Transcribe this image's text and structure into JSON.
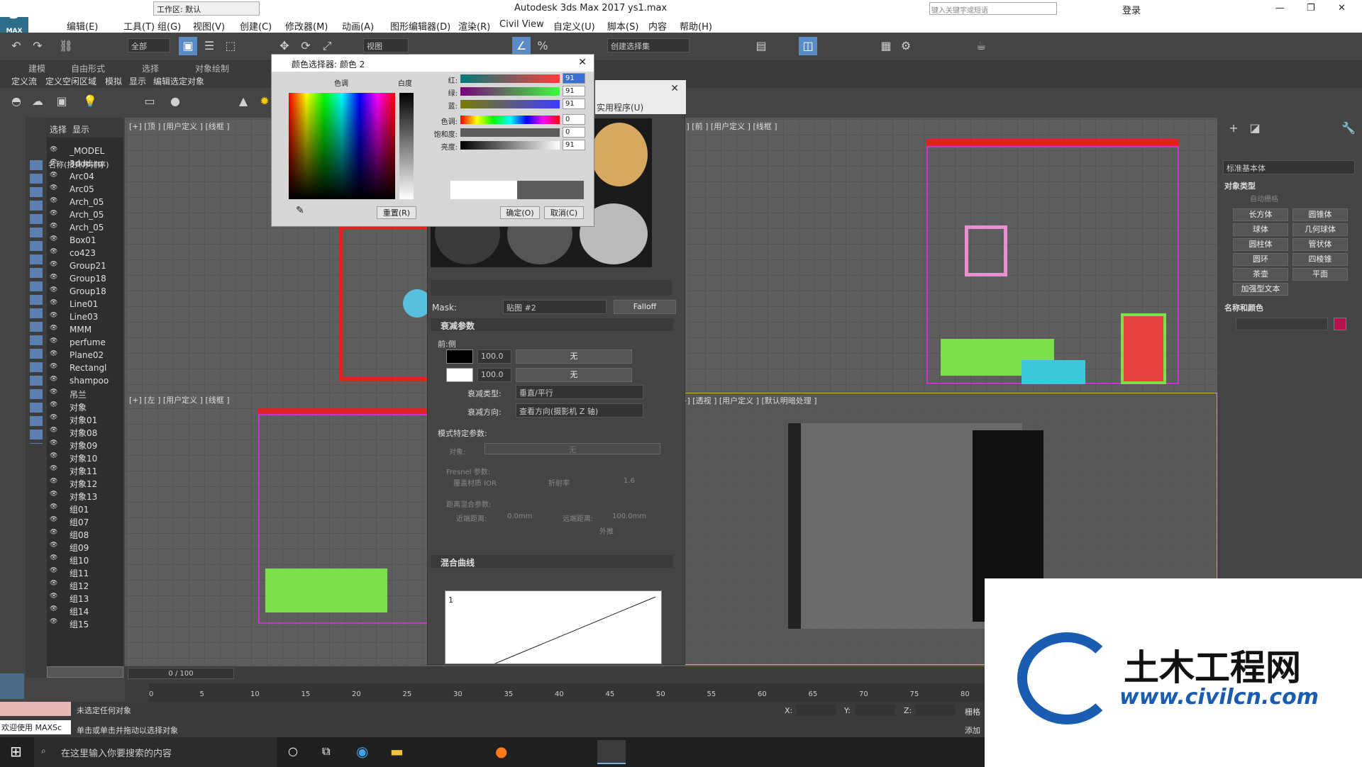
{
  "app": {
    "title": "Autodesk 3ds Max 2017",
    "file": "ys1.max",
    "workspace": "工作区: 默认",
    "search_placeholder": "键入关键字或短语",
    "login": "登录",
    "logo": "3",
    "logo_sub": "MAX"
  },
  "menu": [
    "编辑(E)",
    "工具(T)",
    "组(G)",
    "视图(V)",
    "创建(C)",
    "修改器(M)",
    "动画(A)",
    "图形编辑器(D)",
    "渲染(R)",
    "Civil View",
    "自定义(U)",
    "脚本(S)",
    "内容",
    "帮助(H)"
  ],
  "toolbar": {
    "filter": "全部",
    "view": "视图",
    "selection_set": "创建选择集"
  },
  "ribbon": {
    "tabs": [
      "建模",
      "自由形式",
      "选择",
      "对象绘制"
    ],
    "subtabs": [
      "定义流",
      "定义空闲区域",
      "模拟",
      "显示",
      "编辑选定对象"
    ]
  },
  "scene_explorer": {
    "tabs": [
      "选择",
      "显示"
    ],
    "column": "名称(按升序排序)",
    "items": [
      "_MODEL",
      "3ddd.ru",
      "Arc04",
      "Arc05",
      "Arch_05",
      "Arch_05",
      "Arch_05",
      "Box01",
      "co423",
      "Group21",
      "Group18",
      "Group18",
      "Line01",
      "Line03",
      "MMM",
      "perfume",
      "Plane02",
      "Rectangl",
      "shampoo",
      "吊兰",
      "对象",
      "对象01",
      "对象08",
      "对象09",
      "对象10",
      "对象11",
      "对象12",
      "对象13",
      "组01",
      "组07",
      "组08",
      "组09",
      "组10",
      "组11",
      "组12",
      "组13",
      "组14",
      "组15"
    ]
  },
  "viewports": {
    "top": "[+] [顶 ] [用户定义 ] [线框 ]",
    "front": "[+] [前 ] [用户定义 ] [线框 ]",
    "left": "[+] [左 ] [用户定义 ] [线框 ]",
    "persp": "[+] [透视 ] [用户定义 ] [默认明暗处理 ]"
  },
  "color_picker": {
    "title": "颜色选择器: 颜色 2",
    "hue_label": "色调",
    "white_label": "白度",
    "channels": [
      {
        "label": "红:",
        "value": "91"
      },
      {
        "label": "绿:",
        "value": "91"
      },
      {
        "label": "蓝:",
        "value": "91"
      },
      {
        "label": "色调:",
        "value": "0"
      },
      {
        "label": "饱和度:",
        "value": "0"
      },
      {
        "label": "亮度:",
        "value": "91"
      }
    ],
    "reset": "重置(R)",
    "ok": "确定(O)",
    "cancel": "取消(C)"
  },
  "material_editor": {
    "menu_partial": "实用程序(U)",
    "mask_label": "Mask:",
    "map_name": "贴图 #2",
    "map_type": "Falloff",
    "rollout_falloff": "衰减参数",
    "front_side": "前:侧",
    "amount1": "100.0",
    "amount2": "100.0",
    "none1": "无",
    "none2": "无",
    "falloff_type_label": "衰减类型:",
    "falloff_type": "垂直/平行",
    "falloff_dir_label": "衰减方向:",
    "falloff_dir": "查看方向(摄影机 Z 轴)",
    "mode_params": "模式特定参数:",
    "object_label": "对象:",
    "object_value": "无",
    "fresnel": "Fresnel 参数:",
    "override_ior": "覆盖材质 IOR",
    "ior_label": "折射率",
    "ior_value": "1.6",
    "distance_blend": "距离混合参数:",
    "near_label": "近端距离:",
    "near_value": "0.0mm",
    "far_label": "远端距离:",
    "far_value": "100.0mm",
    "extrapolate": "外推",
    "rollout_curve": "混合曲线",
    "curve_y": "1"
  },
  "command_panel": {
    "category": "标准基本体",
    "object_type": "对象类型",
    "autogrid": "自动栅格",
    "buttons": [
      "长方体",
      "圆锥体",
      "球体",
      "几何球体",
      "圆柱体",
      "管状体",
      "圆环",
      "四棱锥",
      "茶壶",
      "平面",
      "加强型文本"
    ],
    "name_color": "名称和颜色",
    "swatch_color": "#b3124f"
  },
  "timeline": {
    "frame": "0 / 100",
    "ticks": [
      "0",
      "5",
      "10",
      "15",
      "20",
      "25",
      "30",
      "35",
      "40",
      "45",
      "50",
      "55",
      "60",
      "65",
      "70",
      "75",
      "80"
    ]
  },
  "status": {
    "welcome": "欢迎使用 MAXSc",
    "no_selection": "未选定任何对象",
    "hint": "单击或单击并拖动以选择对象",
    "x": "X:",
    "y": "Y:",
    "z": "Z:",
    "grid": "栅格",
    "add": "添加"
  },
  "taskbar": {
    "search": "在这里输入你要搜索的内容"
  },
  "watermark": {
    "cn": "土木工程网",
    "url": "www.civilcn.com"
  }
}
